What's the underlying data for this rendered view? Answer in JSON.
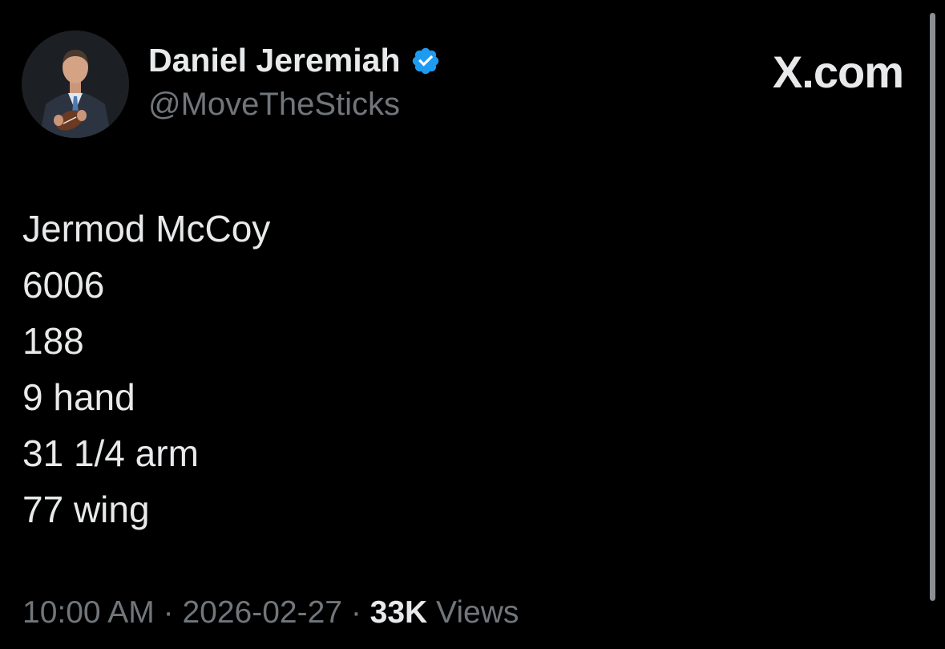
{
  "author": {
    "display_name": "Daniel Jeremiah",
    "handle": "@MoveTheSticks",
    "verified": true,
    "verified_color": "#1d9bf0",
    "avatar": "man-in-suit-holding-football"
  },
  "brand": "X.com",
  "body": {
    "lines": [
      "Jermod McCoy",
      "6006",
      "188",
      "9 hand",
      "31 1/4 arm",
      "77 wing"
    ]
  },
  "meta": {
    "time": "10:00 AM",
    "date": "2026-02-27",
    "separator": "·",
    "views_count": "33K",
    "views_label": "Views"
  },
  "colors": {
    "background": "#000000",
    "primary_text": "#e7e9ea",
    "secondary_text": "#71767b"
  }
}
